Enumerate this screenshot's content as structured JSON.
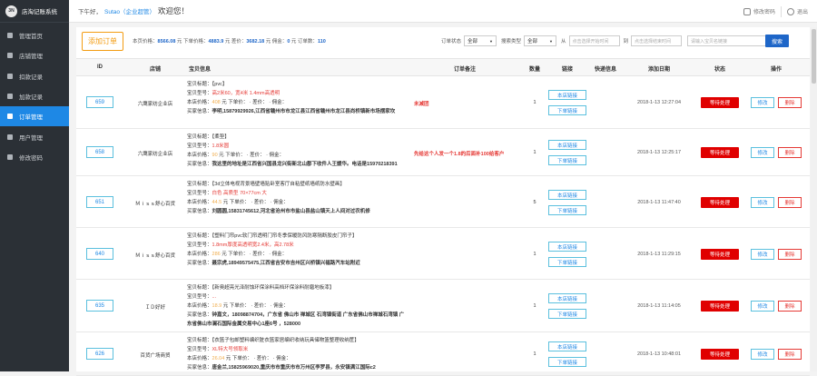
{
  "app_title": "店淘记账系统",
  "logo_text": "3N",
  "sidebar": [
    {
      "label": "管理首页",
      "icon": "home-icon",
      "active": false
    },
    {
      "label": "店铺管理",
      "icon": "shop-icon",
      "active": false
    },
    {
      "label": "扣款记录",
      "icon": "deduct-icon",
      "active": false
    },
    {
      "label": "加款记录",
      "icon": "add-funds-icon",
      "active": false
    },
    {
      "label": "订单管理",
      "icon": "order-icon",
      "active": true
    },
    {
      "label": "用户管理",
      "icon": "users-icon",
      "active": false
    },
    {
      "label": "修改密码",
      "icon": "lock-icon",
      "active": false
    }
  ],
  "topbar": {
    "greeting": "下午好，",
    "user": "Sutao（企业超管）",
    "welcome": "欢迎您！",
    "change_password": "修改密码",
    "logout": "退出"
  },
  "toolbar": {
    "add_order": "添加订单",
    "stats": {
      "label_goods": "本页价格：",
      "goods_value": "8566.08",
      "label_single": " 元 下单价格：",
      "single_value": "4883.9",
      "label_diff": " 元 差价：",
      "diff_value": "3682.18",
      "label_comm": " 元 佣金：",
      "comm_value": "0",
      "label_orders": " 元 订单数：",
      "orders_value": "110"
    },
    "order_status_label": "订单状态",
    "order_status_value": "全部",
    "search_type_label": "搜索类型",
    "search_type_value": "全部",
    "date_from_label": "从",
    "date_from_placeholder": "点击选择开始时间",
    "date_to_label": "到",
    "date_to_placeholder": "点击选择结束时间",
    "keyword_placeholder": "请输入宝贝名链接",
    "search_button": "搜索"
  },
  "table": {
    "headers": [
      "ID",
      "店铺",
      "宝贝信息",
      "订单备注",
      "数量",
      "链接",
      "快递信息",
      "添加日期",
      "状态",
      "操作"
    ],
    "link_top": "本店链接",
    "link_bottom": "下单链接",
    "edit": "修改",
    "delete": "删除",
    "rows": [
      {
        "id": "659",
        "shop": "六鹰家纺企业店",
        "title_label": "宝贝标题：",
        "title": "【pvc】",
        "model_label": "宝贝型号：",
        "model": "高2米60，宽4米 1.4mm高透明",
        "price_label": "本店价格：",
        "price": "408",
        "unit_label": "下单价：",
        "diff_label": "差价：",
        "comm_label": "佣金：",
        "buyer_label": "买家信息：",
        "buyer": "李明,15879929926,江西省赣州市市龙江县江西省赣州市龙江县尚桥镇新市场摆家坎",
        "note": "未减团",
        "qty": "1",
        "date": "2018-1-13 12:27:04",
        "status": "等待处理"
      },
      {
        "id": "658",
        "shop": "六鹰家纺企业店",
        "title_label": "宝贝标题：",
        "title": "【柔垫】",
        "model_label": "宝贝型号：",
        "model": "1.8米圆",
        "price_label": "本店价格：",
        "price": "90",
        "unit_label": "下单价：",
        "diff_label": "差价：",
        "comm_label": "佣金：",
        "buyer_label": "买家信息：",
        "buyer": "我这里的地址是江西省兴国县龙兴街新北山郡下收件人王媛华。电话是15970218391",
        "note": "先给这个人发一个1.8的后面补100给客户",
        "qty": "1",
        "date": "2018-1-13 12:25:17",
        "status": "等待处理"
      },
      {
        "id": "651",
        "shop": "Ｍｉｓｓ舒心百货",
        "title_label": "宝贝标题：",
        "title": "【3d立体电视背景墙壁墙贴卧室客厅自粘壁纸墙纸防水壁画】",
        "model_label": "宝贝型号：",
        "model": "白色 高质型 70×77cm 大",
        "price_label": "本店价格：",
        "price": "44.5",
        "unit_label": "下单价：",
        "diff_label": "差价：",
        "comm_label": "佣金：",
        "buyer_label": "买家信息：",
        "buyer": "刘圆圆,15831745612,河北省沧州市市盐山县盐山镇天上人间对过农机修",
        "note": "",
        "qty": "5",
        "date": "2018-1-13 11:47:40",
        "status": "等待处理"
      },
      {
        "id": "640",
        "shop": "Ｍｉｓｓ舒心百货",
        "title_label": "宝贝标题：",
        "title": "【塑料门帘pvc软门帘透明门帘冬季保暖防风防寒隔断胶皮门帘子】",
        "model_label": "宝贝型号：",
        "model": "1.8mm厚度高透明宽2.4米，高2.78米",
        "price_label": "本店价格：",
        "price": "286",
        "unit_label": "下单价：",
        "diff_label": "差价：",
        "comm_label": "佣金：",
        "buyer_label": "买家信息：",
        "buyer": "聂宗虎,18949575475,江西省吉安市吉州区兴桥镇兴福路汽车站附近",
        "note": "",
        "qty": "1",
        "date": "2018-1-13 11:29:15",
        "status": "等待处理"
      },
      {
        "id": "635",
        "shop": "ＩＤ好好",
        "title_label": "宝贝标题：",
        "title": "【新奥超亮光泽耐蚀环保涂料高档环保涂料耐磨地板漆】",
        "model_label": "宝贝型号：",
        "model": "...",
        "price_label": "本店价格：",
        "price": "18.9",
        "unit_label": "下单价：",
        "diff_label": "差价：",
        "comm_label": "佣金：",
        "buyer_label": "买家信息：",
        "buyer": "钟嘉文，18098874704，广东省 佛山市 禅城区 石湾镇街道 广东省佛山市禅城石湾镇 广东省佛山市澜石国际金属交易中心1座6号 ，528000",
        "note": "",
        "qty": "1",
        "date": "2018-1-13 11:14:05",
        "status": "等待处理"
      },
      {
        "id": "626",
        "shop": "百货广场商贸",
        "title_label": "宝贝标题：",
        "title": "【衣篮子包邮塑料编织脏衣篮家居编织收纳玩具储物篮整理收纳筐】",
        "model_label": "宝贝型号：",
        "model": "XL特大号领取米",
        "price_label": "本店价格：",
        "price": "26.04",
        "unit_label": "下单价：",
        "diff_label": "差价：",
        "comm_label": "佣金：",
        "buyer_label": "买家信息：",
        "buyer": "唐金兰,15825969020,重庆市市重庆市市万州区李罗县，永安镇满江国际c2",
        "note": "",
        "qty": "1",
        "date": "2018-1-13 10:48:01",
        "status": "等待处理"
      }
    ]
  },
  "colors": {
    "sidebar_bg": "#2b3036",
    "active": "#1e88e5",
    "status_red": "#e00000",
    "accent_orange": "#f39c12"
  }
}
